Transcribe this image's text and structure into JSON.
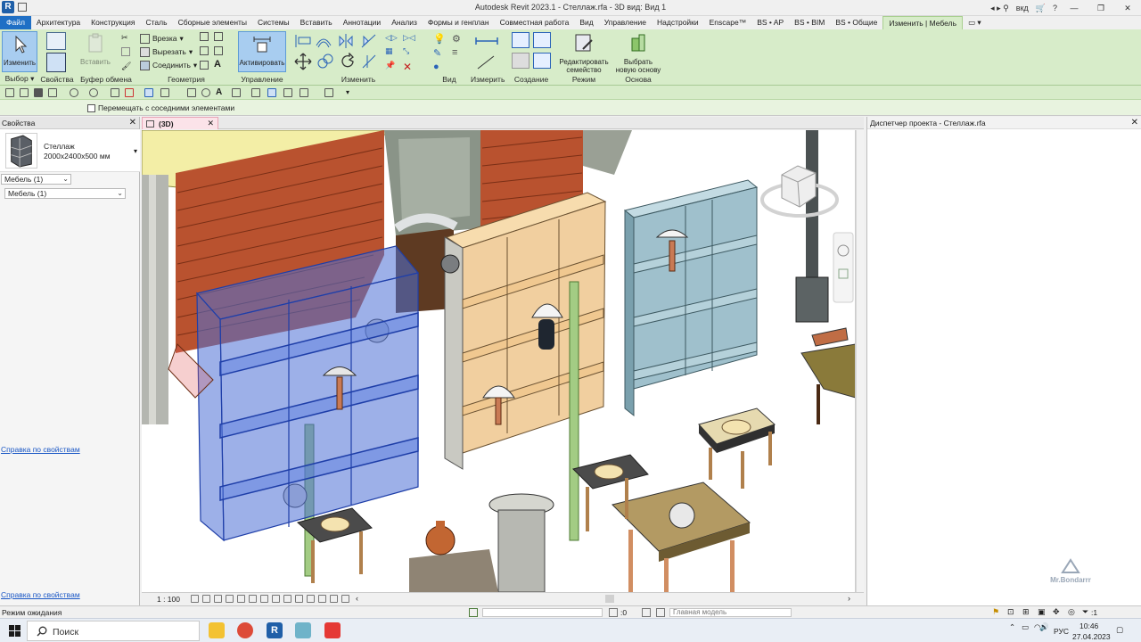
{
  "window": {
    "title": "Autodesk Revit 2023.1 - Стеллаж.rfa - 3D вид: Вид 1",
    "app_initial": "R",
    "user_short": "вкд"
  },
  "tabs": [
    "Файл",
    "Архитектура",
    "Конструкция",
    "Сталь",
    "Сборные элементы",
    "Системы",
    "Вставить",
    "Аннотации",
    "Анализ",
    "Формы и генплан",
    "Совместная работа",
    "Вид",
    "Управление",
    "Надстройки",
    "Enscape™",
    "BS • AP",
    "BS • BIM",
    "BS • Общие",
    "Изменить | Мебель"
  ],
  "ribbon": {
    "modify_label": "Изменить",
    "paste_label": "Вставить",
    "cut_notch": "Врезка",
    "cut": "Вырезать",
    "join": "Соединить",
    "activate": "Активировать",
    "edit_family": "Редактировать семейство",
    "pick_host": "Выбрать новую основу",
    "groups": {
      "select": "Выбор",
      "properties": "Свойства",
      "clipboard": "Буфер обмена",
      "geometry": "Геометрия",
      "control": "Управление",
      "modify": "Изменить",
      "view": "Вид",
      "measure": "Измерить",
      "create": "Создание",
      "mode": "Режим",
      "host": "Основа"
    }
  },
  "options_bar": {
    "checkbox_label": "Перемещать с соседними элементами",
    "checked": false
  },
  "properties": {
    "title": "Свойства",
    "type_name": "Стеллаж",
    "type_size": "2000x2400x500 мм",
    "filter_value": "Мебель (1)",
    "instance_value": "Мебель (1)",
    "help_link": "Справка по свойствам"
  },
  "view": {
    "tab_label": "(3D)",
    "scale": "1 : 100"
  },
  "project_browser": {
    "title": "Диспетчер проекта - Стеллаж.rfa"
  },
  "status": {
    "text": "Режим ожидания",
    "zero": ":0",
    "model": "Главная модель",
    "filter_count": ":1"
  },
  "taskbar": {
    "search_label": "Поиск",
    "lang": "РУС",
    "time": "10:46",
    "date": "27.04.2023"
  },
  "watermark": "Mr.Bondarrr",
  "colors": {
    "ribbon_bg": "#d7ecc9",
    "file_tab": "#1f6fc5",
    "selection_blue": "#4d6fd6",
    "shelf_wood": "#f1cf9f",
    "shelf_gray_blue": "#9fc0cc",
    "brick_wall": "#b9522f"
  }
}
